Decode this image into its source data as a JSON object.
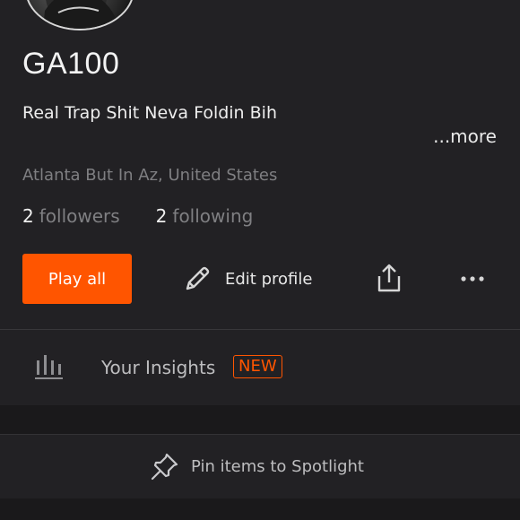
{
  "profile": {
    "username": "GA100",
    "bio": "Real Trap Shit Neva Foldin Bih",
    "more_label": "...more",
    "location": "Atlanta But In Az, United States",
    "followers_count": "2",
    "followers_label": "followers",
    "following_count": "2",
    "following_label": "following"
  },
  "actions": {
    "play_all_label": "Play all",
    "edit_profile_label": "Edit profile"
  },
  "insights": {
    "label": "Your Insights",
    "badge": "NEW"
  },
  "spotlight": {
    "label": "Pin items to Spotlight"
  },
  "colors": {
    "accent": "#ff5500",
    "background": "#222124",
    "muted_text": "#7f7f82"
  },
  "icons": {
    "edit": "pencil-icon",
    "share": "share-icon",
    "more": "more-dots-icon",
    "insights": "bar-chart-icon",
    "pin": "pin-icon"
  }
}
